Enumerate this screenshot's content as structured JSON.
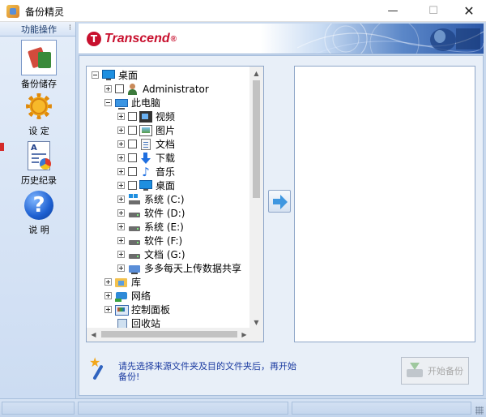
{
  "window": {
    "title": "备份精灵",
    "min_glyph": "—",
    "max_glyph": "☐",
    "close_glyph": "✕"
  },
  "sidebar": {
    "header": "功能操作",
    "grip": "⁝",
    "items": [
      {
        "label": "备份储存",
        "icon": "backup-icon"
      },
      {
        "label": "设 定",
        "icon": "gear-icon"
      },
      {
        "label": "历史纪录",
        "icon": "history-icon"
      },
      {
        "label": "说 明",
        "icon": "help-icon"
      }
    ]
  },
  "banner": {
    "brand": "Transcend",
    "registered": "®"
  },
  "tree": {
    "items": [
      {
        "label": "桌面"
      },
      {
        "label": "Administrator"
      },
      {
        "label": "此电脑"
      },
      {
        "label": "视频"
      },
      {
        "label": "图片"
      },
      {
        "label": "文档"
      },
      {
        "label": "下载"
      },
      {
        "label": "音乐"
      },
      {
        "label": "桌面"
      },
      {
        "label": "系统 (C:)"
      },
      {
        "label": "软件 (D:)"
      },
      {
        "label": "系统 (E:)"
      },
      {
        "label": "软件 (F:)"
      },
      {
        "label": "文档 (G:)"
      },
      {
        "label": "多多每天上传数据共享"
      },
      {
        "label": "库"
      },
      {
        "label": "网络"
      },
      {
        "label": "控制面板"
      },
      {
        "label": "回收站"
      }
    ]
  },
  "scrollbar": {
    "up": "▲",
    "down": "▼",
    "left": "◀",
    "right": "▶"
  },
  "hint": {
    "text": "请先选择来源文件夹及目的文件夹后，再开始备份!"
  },
  "actions": {
    "start_backup": "开始备份"
  },
  "colors": {
    "accent": "#1e8fe0",
    "brand": "#c8102e",
    "hint_text": "#1a3aa0"
  }
}
